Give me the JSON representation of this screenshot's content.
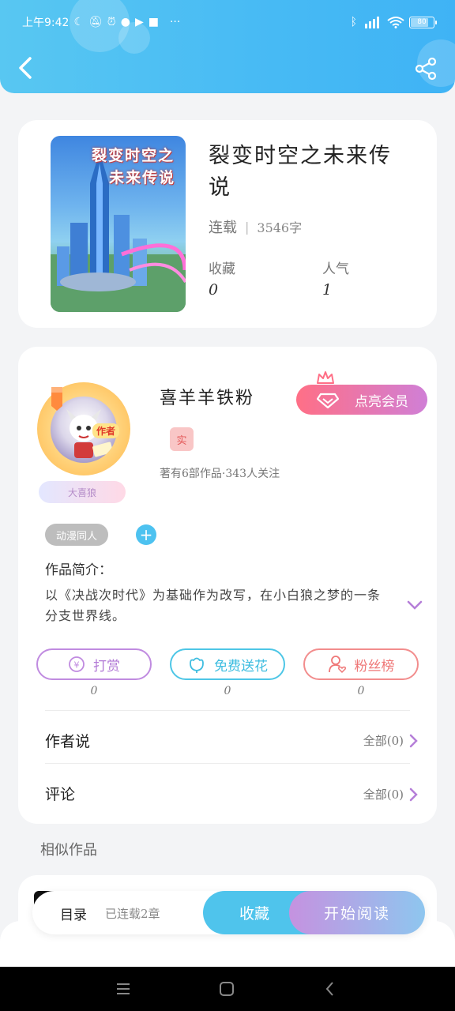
{
  "status_bar": {
    "time": "上午9:42",
    "more": "···",
    "battery": "80",
    "battery_level": 0.8
  },
  "header": {
    "back_icon": "chevron-left-icon",
    "share_icon": "share-icon"
  },
  "book": {
    "cover_text_line1": "裂变时空之",
    "cover_text_line2": "未来传说",
    "title": "裂变时空之未来传说",
    "status": "连载",
    "word_count": "3546字",
    "collect_label": "收藏",
    "collect_value": "0",
    "popularity_label": "人气",
    "popularity_value": "1"
  },
  "author": {
    "badge": "作者",
    "level": "大喜狼",
    "name": "喜羊羊铁粉",
    "verified": "实",
    "info": "著有6部作品·343人关注",
    "vip_button": "点亮会员"
  },
  "details": {
    "tag": "动漫同人",
    "add_tag": "+",
    "intro_label": "作品简介：",
    "intro_text": "以《决战次时代》为基础作为改写，在小白狼之梦的一条分支世界线。"
  },
  "actions": [
    {
      "label": "打赏",
      "count": "0",
      "icon": "coin-icon"
    },
    {
      "label": "免费送花",
      "count": "0",
      "icon": "flower-icon"
    },
    {
      "label": "粉丝榜",
      "count": "0",
      "icon": "user-heart-icon"
    }
  ],
  "author_says": {
    "label": "作者说",
    "link": "全部(0)"
  },
  "comments": {
    "label": "评论",
    "link": "全部(0)"
  },
  "similar": {
    "title": "相似作品"
  },
  "bottom_bar": {
    "toc": "目录",
    "toc_status": "已连载2章",
    "favorite": "收藏",
    "start_reading": "开始阅读"
  },
  "colors": {
    "header": "#47baf4",
    "vip_start": "#ff6f86",
    "vip_end": "#d07fd6",
    "accent_blue": "#4fc4ec",
    "accent_purple": "#c592e0"
  }
}
